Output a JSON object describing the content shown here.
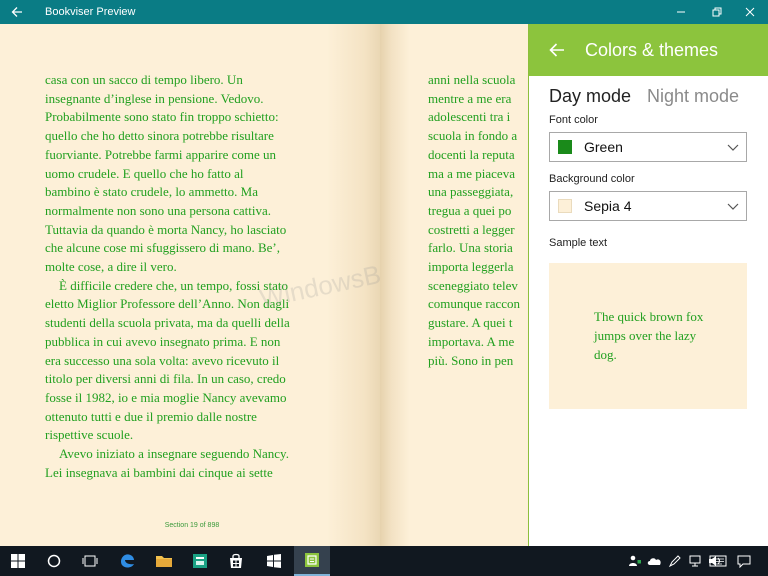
{
  "window": {
    "title": "Bookviser Preview"
  },
  "book": {
    "left_page": [
      {
        "text": "casa con un sacco di tempo libero. Un",
        "indent": false
      },
      {
        "text": "insegnante d’inglese in pensione. Vedovo.",
        "indent": false
      },
      {
        "text": "Probabilmente sono stato fin troppo schietto:",
        "indent": false
      },
      {
        "text": "quello che ho detto sinora potrebbe risultare",
        "indent": false
      },
      {
        "text": "fuorviante. Potrebbe farmi apparire come un",
        "indent": false
      },
      {
        "text": "uomo crudele. E quello che ho fatto al",
        "indent": false
      },
      {
        "text": "bambino è stato crudele, lo ammetto. Ma",
        "indent": false
      },
      {
        "text": "normalmente non sono una persona cattiva.",
        "indent": false
      },
      {
        "text": "Tuttavia da quando è morta Nancy, ho lasciato",
        "indent": false
      },
      {
        "text": "che alcune cose mi sfuggissero di mano. Be’,",
        "indent": false
      },
      {
        "text": "molte cose, a dire il vero.",
        "indent": false
      },
      {
        "text": "È difficile credere che, un tempo, fossi stato",
        "indent": true
      },
      {
        "text": "eletto Miglior Professore dell’Anno. Non dagli",
        "indent": false
      },
      {
        "text": "studenti della scuola privata, ma da quelli della",
        "indent": false
      },
      {
        "text": "pubblica in cui avevo insegnato prima. E non",
        "indent": false
      },
      {
        "text": "era successo una sola volta: avevo ricevuto il",
        "indent": false
      },
      {
        "text": "titolo per diversi anni di fila. In un caso, credo",
        "indent": false
      },
      {
        "text": "fosse il 1982, io e mia moglie Nancy avevamo",
        "indent": false
      },
      {
        "text": "ottenuto tutti e due il premio dalle nostre",
        "indent": false
      },
      {
        "text": "rispettive scuole.",
        "indent": false
      },
      {
        "text": "Avevo iniziato a insegnare seguendo Nancy.",
        "indent": true
      },
      {
        "text": "Lei insegnava ai bambini dai cinque ai sette",
        "indent": false
      }
    ],
    "right_page": [
      "anni nella scuola",
      "mentre a me era",
      "adolescenti tra i",
      "scuola in fondo a",
      "docenti la reputa",
      "ma a me piaceva",
      "una passeggiata,",
      "tregua a quei po",
      "costretti a legger",
      "farlo. Una storia",
      "importa leggerla",
      "sceneggiato telev",
      "comunque raccon",
      "gustare. A quei t",
      "importava. A me",
      "più. Sono in pen"
    ],
    "section_label": "Section 19 of 898",
    "watermark": "WindowsBlogItalia"
  },
  "panel": {
    "title": "Colors & themes",
    "tabs": [
      "Day mode",
      "Night mode"
    ],
    "selected_tab": "Day mode",
    "font_color_label": "Font color",
    "font_color_value": "Green",
    "font_color_swatch": "#1a8a1a",
    "background_color_label": "Background color",
    "background_color_value": "Sepia 4",
    "background_color_swatch": "#fdf0d8",
    "sample_label": "Sample text",
    "sample_text": "The quick brown fox jumps over the lazy dog."
  },
  "colors": {
    "titlebar": "#0a7c85",
    "panel_header": "#8cc43d",
    "text": "#22a020",
    "page": "#fdf0d8",
    "taskbar": "#111820"
  },
  "taskbar": {
    "apps": [
      "windows-start",
      "cortana",
      "task-view",
      "edge",
      "file-explorer",
      "app-store-green",
      "windows-store",
      "blue-app",
      "bookviser"
    ],
    "active_app": "bookviser",
    "tray": [
      "people",
      "onedrive",
      "pen",
      "network",
      "volume",
      "keyboard",
      "action-center"
    ]
  }
}
